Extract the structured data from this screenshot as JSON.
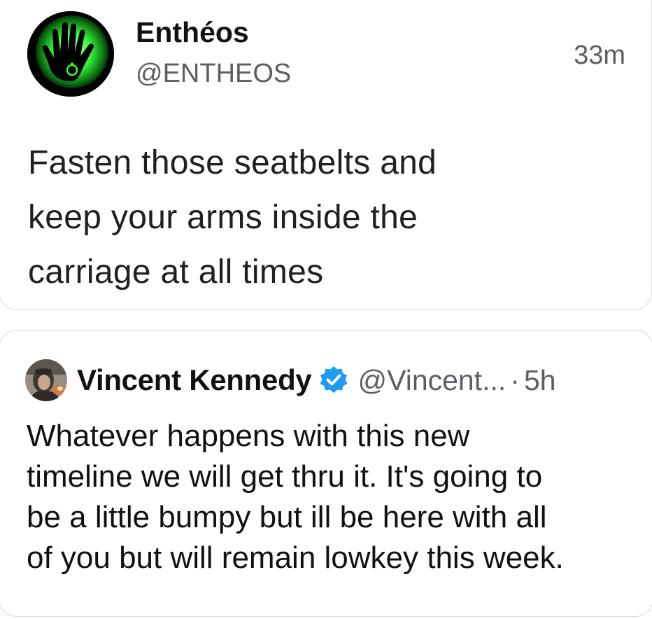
{
  "post": {
    "author_name": "Enthéos",
    "author_handle": "@ENTHEOS",
    "time": "33m",
    "avatar_icon": "glowing-hand-icon",
    "text_lines": [
      "Fasten those seatbelts and",
      "keep your arms inside the",
      "carriage at all times"
    ]
  },
  "quoted": {
    "author_name": "Vincent Kennedy",
    "verified_icon": "verified-badge-icon",
    "author_handle": "@Vincent...",
    "separator": "·",
    "time": "5h",
    "text_lines": [
      "Whatever happens with this new",
      "timeline we will get thru it. It's going to",
      "be a little bumpy but ill be here with all",
      "of you but will remain lowkey this week."
    ]
  },
  "colors": {
    "text_primary": "#111111",
    "text_secondary": "#5b5f63",
    "verified_blue": "#1d9bf0",
    "avatar_glow_green": "#39ff3c",
    "border": "#dcdcdc"
  }
}
